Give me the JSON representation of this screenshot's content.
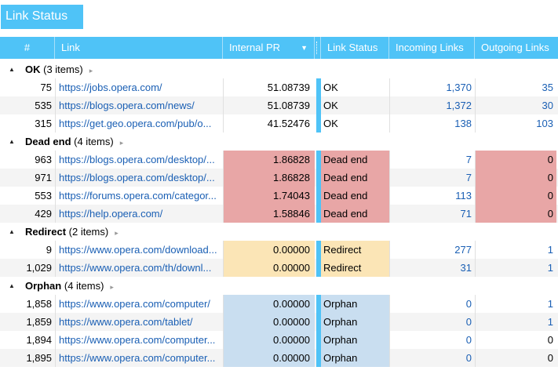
{
  "window": {
    "title": "Link Status"
  },
  "columns": {
    "num": "#",
    "link": "Link",
    "internal_pr": "Internal PR",
    "link_status": "Link Status",
    "incoming": "Incoming Links",
    "outgoing": "Outgoing Links"
  },
  "sort": {
    "column": "Internal PR",
    "direction": "descending"
  },
  "colors": {
    "header": "#4fc3f7",
    "dead_end": "#e8a6a6",
    "redirect": "#fbe5b6",
    "orphan": "#c9def0",
    "link_text": "#1a5fb4"
  },
  "groups": [
    {
      "name": "OK",
      "count": "(3 items)",
      "rows": [
        {
          "num": "75",
          "link": "https://jobs.opera.com/",
          "pr": "51.08739",
          "status": "OK",
          "in": "1,370",
          "out": "35"
        },
        {
          "num": "535",
          "link": "https://blogs.opera.com/news/",
          "pr": "51.08739",
          "status": "OK",
          "in": "1,372",
          "out": "30"
        },
        {
          "num": "315",
          "link": "https://get.geo.opera.com/pub/o...",
          "pr": "41.52476",
          "status": "OK",
          "in": "138",
          "out": "103"
        }
      ]
    },
    {
      "name": "Dead end",
      "count": "(4 items)",
      "rows": [
        {
          "num": "963",
          "link": "https://blogs.opera.com/desktop/...",
          "pr": "1.86828",
          "status": "Dead end",
          "in": "7",
          "out": "0"
        },
        {
          "num": "971",
          "link": "https://blogs.opera.com/desktop/...",
          "pr": "1.86828",
          "status": "Dead end",
          "in": "7",
          "out": "0"
        },
        {
          "num": "553",
          "link": "https://forums.opera.com/categor...",
          "pr": "1.74043",
          "status": "Dead end",
          "in": "113",
          "out": "0"
        },
        {
          "num": "429",
          "link": "https://help.opera.com/",
          "pr": "1.58846",
          "status": "Dead end",
          "in": "71",
          "out": "0"
        }
      ]
    },
    {
      "name": "Redirect",
      "count": "(2 items)",
      "rows": [
        {
          "num": "9",
          "link": "https://www.opera.com/download...",
          "pr": "0.00000",
          "status": "Redirect",
          "in": "277",
          "out": "1"
        },
        {
          "num": "1,029",
          "link": "https://www.opera.com/th/downl...",
          "pr": "0.00000",
          "status": "Redirect",
          "in": "31",
          "out": "1"
        }
      ]
    },
    {
      "name": "Orphan",
      "count": "(4 items)",
      "rows": [
        {
          "num": "1,858",
          "link": "https://www.opera.com/computer/",
          "pr": "0.00000",
          "status": "Orphan",
          "in": "0",
          "out": "1"
        },
        {
          "num": "1,859",
          "link": "https://www.opera.com/tablet/",
          "pr": "0.00000",
          "status": "Orphan",
          "in": "0",
          "out": "1"
        },
        {
          "num": "1,894",
          "link": "https://www.opera.com/computer...",
          "pr": "0.00000",
          "status": "Orphan",
          "in": "0",
          "out": "0"
        },
        {
          "num": "1,895",
          "link": "https://www.opera.com/computer...",
          "pr": "0.00000",
          "status": "Orphan",
          "in": "0",
          "out": "0"
        }
      ]
    }
  ]
}
